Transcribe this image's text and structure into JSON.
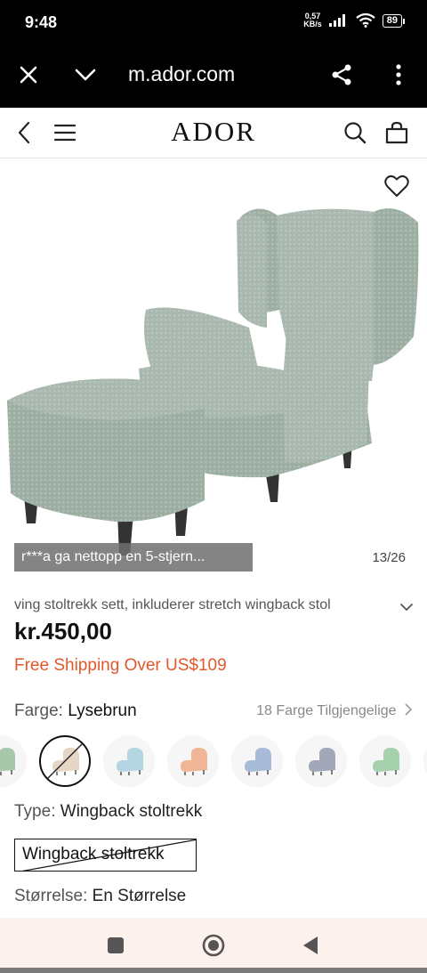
{
  "status_bar": {
    "time": "9:48",
    "net_speed_value": "0,57",
    "net_speed_unit": "KB/s",
    "battery": "89"
  },
  "browser": {
    "url": "m.ador.com",
    "icons": [
      "close-icon",
      "chevron-down-icon",
      "share-icon",
      "more-vertical-icon"
    ]
  },
  "header": {
    "logo": "ADOR",
    "icons": [
      "back-icon",
      "menu-icon",
      "search-icon",
      "shopping-bag-icon"
    ]
  },
  "gallery": {
    "review_toast": "r***a ga nettopp en 5-stjern...",
    "counter": "13/26"
  },
  "product": {
    "title": "ving stoltrekk sett, inkluderer stretch wingback stol",
    "price": "kr.450,00",
    "shipping": "Free Shipping Over US$109",
    "color_label": "Farge:",
    "color_value": "Lysebrun",
    "colors_available": "18 Farge Tilgjengelige",
    "swatches": [
      {
        "color": "#a9c7ab"
      },
      {
        "color": "#e6d6c4",
        "selected": true,
        "unavailable": true
      },
      {
        "color": "#b6d5e2"
      },
      {
        "color": "#f0b595"
      },
      {
        "color": "#a9bcd7"
      },
      {
        "color": "#a3a8b9"
      },
      {
        "color": "#a6d1ad"
      },
      {
        "color": "#cfd3cc"
      }
    ],
    "type_label": "Type:",
    "type_value": "Wingback stoltrekk",
    "type_option": "Wingback stoltrekk",
    "size_label": "Størrelse:",
    "size_value": "En Størrelse"
  },
  "colors": {
    "accent_orange": "#e2572b",
    "chair_green": "#a8b8ae",
    "nav_bg": "#fdf1ed"
  }
}
